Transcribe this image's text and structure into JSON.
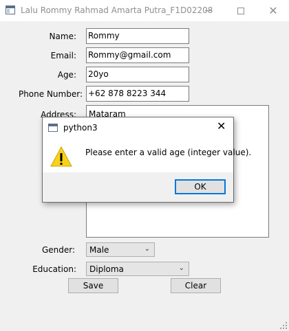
{
  "window": {
    "title": "Lalu Rommy Rahmad Amarta Putra_F1D02208",
    "close_glyph": "✕"
  },
  "form": {
    "name_label": "Name:",
    "name_value": "Rommy",
    "email_label": "Email:",
    "email_value": "Rommy@gmail.com",
    "age_label": "Age:",
    "age_value": "20yo",
    "phone_label": "Phone Number:",
    "phone_value": "+62 878 8223 344",
    "address_label": "Address:",
    "address_value": "Mataram",
    "gender_label": "Gender:",
    "gender_value": "Male",
    "education_label": "Education:",
    "education_value": "Diploma",
    "save_label": "Save",
    "clear_label": "Clear"
  },
  "dialog": {
    "title": "python3",
    "message": "Please enter a valid age (integer value).",
    "ok_label": "OK",
    "close_glyph": "✕"
  },
  "colors": {
    "warning_yellow": "#f8d11c",
    "focus_blue": "#0078d7"
  },
  "icons": {
    "app": "app-window-icon",
    "warning": "warning-icon"
  }
}
